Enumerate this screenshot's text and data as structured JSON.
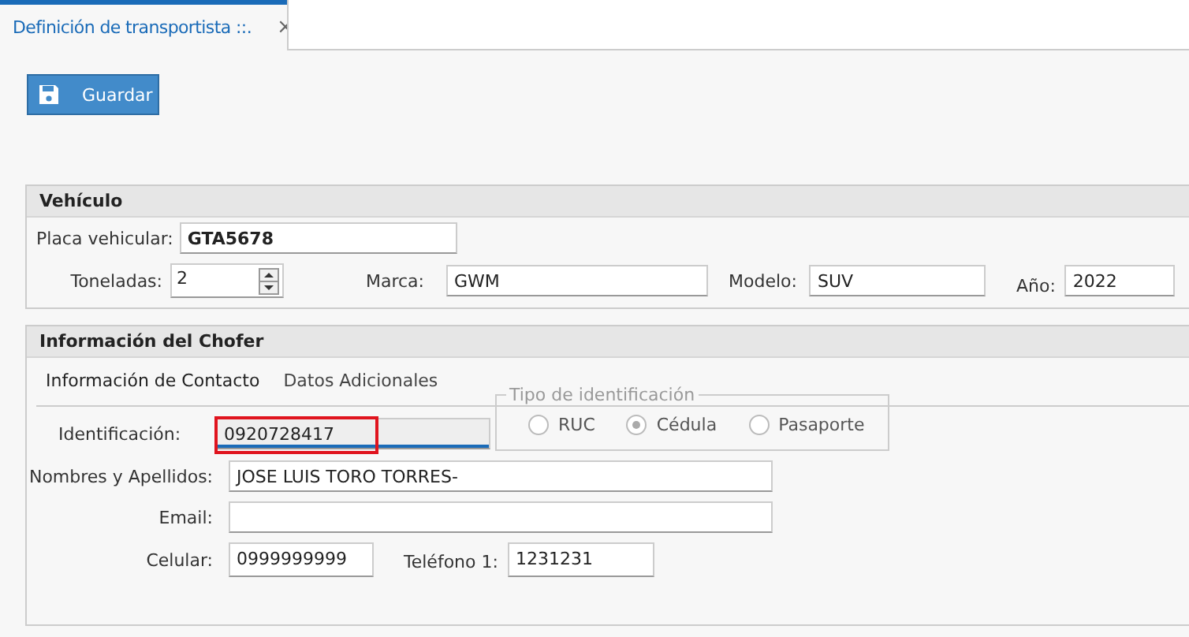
{
  "tab": {
    "title": "Definición de transportista ::.",
    "close": "×"
  },
  "toolbar": {
    "save_button": "Guardar"
  },
  "vehicle": {
    "title": "Vehículo",
    "plate_label": "Placa vehicular:",
    "plate": "GTA5678",
    "tons_label": "Toneladas:",
    "tons": "2",
    "brand_label": "Marca:",
    "brand": "GWM",
    "model_label": "Modelo:",
    "model": "SUV",
    "year_label": "Año:",
    "year": "2022"
  },
  "driver": {
    "title": "Información del Chofer",
    "tabs": [
      {
        "label": "Información de Contacto",
        "selected": true
      },
      {
        "label": "Datos Adicionales",
        "selected": false
      }
    ],
    "id_label": "Identificación:",
    "id_value": "0920728417",
    "id_disabled": true,
    "id_highlighted": true,
    "id_type": {
      "legend": "Tipo de identificación",
      "disabled": true,
      "options": [
        {
          "label": "RUC",
          "selected": false
        },
        {
          "label": "Cédula",
          "selected": true
        },
        {
          "label": "Pasaporte",
          "selected": false
        }
      ]
    },
    "name_label": "Nombres y Apellidos:",
    "name": "JOSE LUIS TORO TORRES-",
    "email_label": "Email:",
    "mobile_label": "Celular:",
    "mobile": "0999999999",
    "phone_label": "Teléfono 1:",
    "phone": "1231231"
  }
}
